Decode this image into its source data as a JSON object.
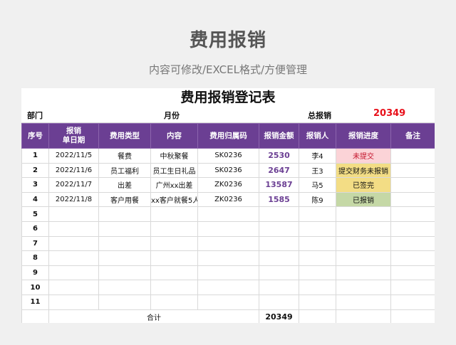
{
  "page": {
    "title": "费用报销",
    "subtitle": "内容可修改/EXCEL格式/方便管理"
  },
  "sheet": {
    "title": "费用报销登记表",
    "dept_label": "部门",
    "month_label": "月份",
    "total_label": "总报销",
    "total_value": "20349"
  },
  "table": {
    "headers": [
      "序号",
      "报销\n单日期",
      "费用类型",
      "内容",
      "费用归属码",
      "报销金额",
      "报销人",
      "报销进度",
      "备注"
    ],
    "rows": [
      {
        "no": "1",
        "date": "2022/11/5",
        "type": "餐费",
        "content": "中秋聚餐",
        "code": "SK0236",
        "amount": "2530",
        "person": "李4",
        "status": "未提交",
        "status_color": "#fbd3d7",
        "note": ""
      },
      {
        "no": "2",
        "date": "2022/11/6",
        "type": "员工福利",
        "content": "员工生日礼品",
        "code": "SK0236",
        "amount": "2647",
        "person": "王3",
        "status": "提交财务未报销",
        "status_color": "#f3dd85",
        "note": ""
      },
      {
        "no": "3",
        "date": "2022/11/7",
        "type": "出差",
        "content": "广州xx出差",
        "code": "ZK0236",
        "amount": "13587",
        "person": "马5",
        "status": "已签完",
        "status_color": "#f3dd85",
        "note": ""
      },
      {
        "no": "4",
        "date": "2022/11/8",
        "type": "客户用餐",
        "content": "xx客户就餐5人",
        "code": "ZK0236",
        "amount": "1585",
        "person": "陈9",
        "status": "已报销",
        "status_color": "#c5d8a6",
        "note": ""
      },
      {
        "no": "5",
        "date": "",
        "type": "",
        "content": "",
        "code": "",
        "amount": "",
        "person": "",
        "status": "",
        "note": ""
      },
      {
        "no": "6",
        "date": "",
        "type": "",
        "content": "",
        "code": "",
        "amount": "",
        "person": "",
        "status": "",
        "note": ""
      },
      {
        "no": "7",
        "date": "",
        "type": "",
        "content": "",
        "code": "",
        "amount": "",
        "person": "",
        "status": "",
        "note": ""
      },
      {
        "no": "8",
        "date": "",
        "type": "",
        "content": "",
        "code": "",
        "amount": "",
        "person": "",
        "status": "",
        "note": ""
      },
      {
        "no": "9",
        "date": "",
        "type": "",
        "content": "",
        "code": "",
        "amount": "",
        "person": "",
        "status": "",
        "note": ""
      },
      {
        "no": "10",
        "date": "",
        "type": "",
        "content": "",
        "code": "",
        "amount": "",
        "person": "",
        "status": "",
        "note": ""
      },
      {
        "no": "11",
        "date": "",
        "type": "",
        "content": "",
        "code": "",
        "amount": "",
        "person": "",
        "status": "",
        "note": ""
      }
    ],
    "total_label": "合计",
    "total_amount": "20349"
  }
}
